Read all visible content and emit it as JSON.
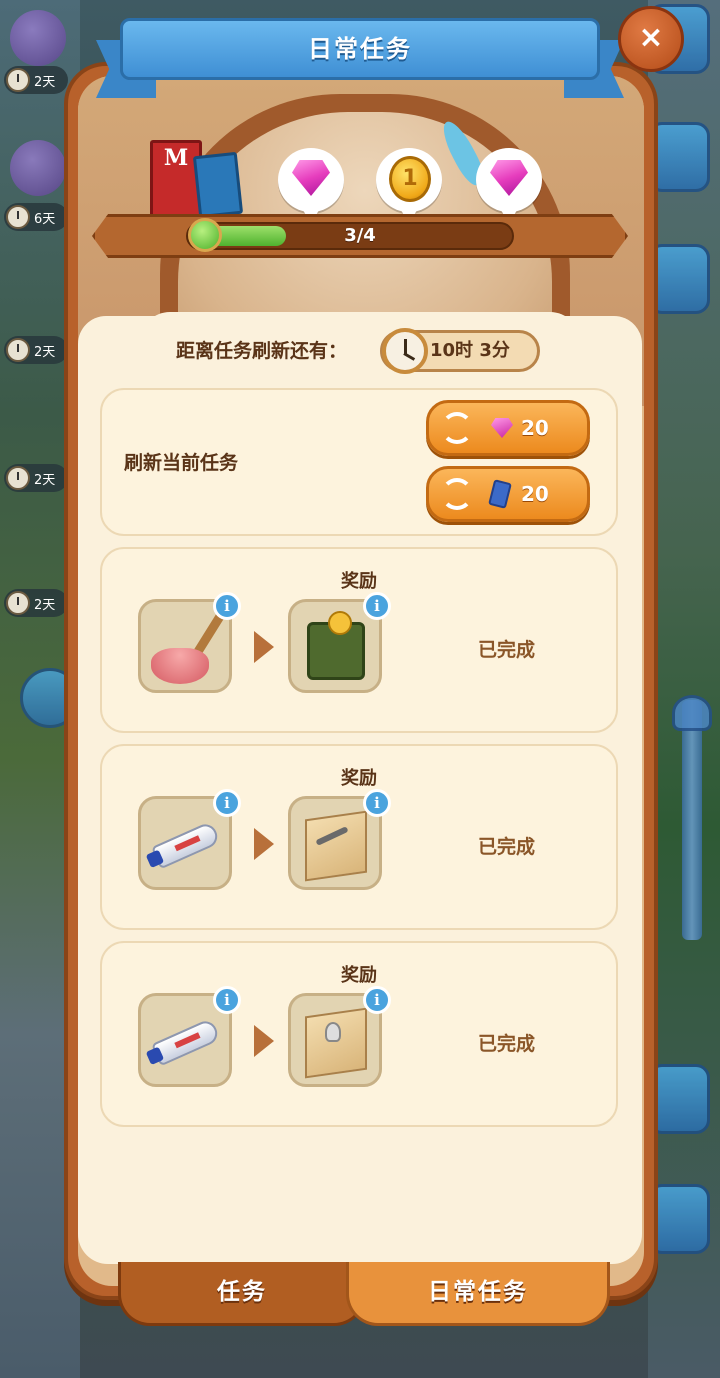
{
  "dialog": {
    "title": "日常任务",
    "close_label": "×"
  },
  "side_timers": [
    "2天",
    "6天",
    "2天",
    "2天",
    "2天"
  ],
  "progress": {
    "text": "3/4",
    "fraction": 0.3,
    "rewards": [
      "gem-icon",
      "coin-icon",
      "gem-icon"
    ],
    "coin_symbol": "1"
  },
  "shelf": {
    "book_letter": "M"
  },
  "refresh_timer": {
    "label": "距离任务刷新还有：",
    "time": "10时 3分"
  },
  "refresh_card": {
    "label": "刷新当前任务",
    "gem_cost": "20",
    "card_cost": "20"
  },
  "tasks": [
    {
      "reward_label": "奖励",
      "input_item": "plunger-icon",
      "output_item": "coin-box-icon",
      "status": "已完成"
    },
    {
      "reward_label": "奖励",
      "input_item": "toothpaste-tube-icon",
      "output_item": "wrench-crate-icon",
      "status": "已完成"
    },
    {
      "reward_label": "奖励",
      "input_item": "toothpaste-tube-icon",
      "output_item": "bulb-crate-icon",
      "status": "已完成"
    }
  ],
  "info_symbol": "i",
  "tabs": [
    {
      "label": "任务",
      "active": false
    },
    {
      "label": "日常任务",
      "active": true
    }
  ],
  "colors": {
    "accent_orange": "#ec8a1e",
    "panel_brown": "#b8612b",
    "title_blue": "#3f8fd4",
    "progress_green": "#4fb22e"
  }
}
